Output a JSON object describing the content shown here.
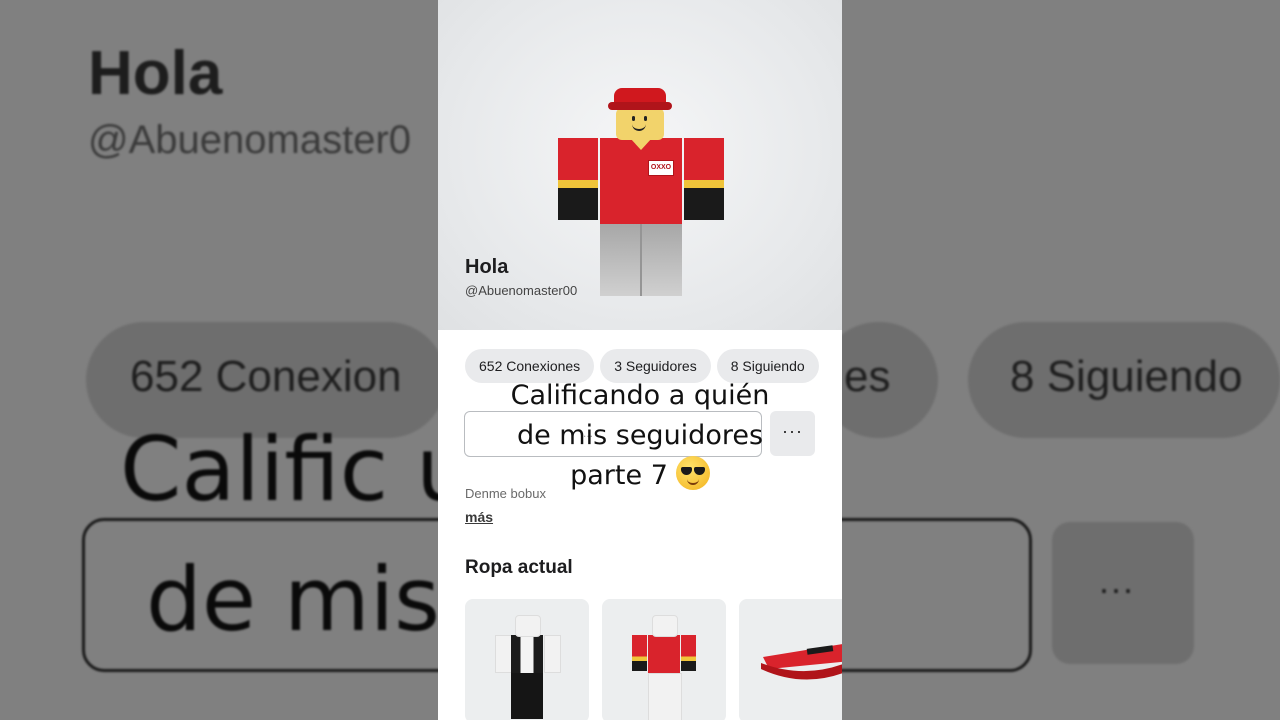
{
  "profile": {
    "display_name": "Hola",
    "username": "@Abuenomaster00"
  },
  "stats": [
    {
      "label": "652 Conexiones"
    },
    {
      "label": "3 Seguidores"
    },
    {
      "label": "8 Siguiendo"
    }
  ],
  "status_input": {
    "partial_text": "..."
  },
  "more_button": {
    "label": "···"
  },
  "bio": {
    "text": "Denme bobux",
    "more_link": "más"
  },
  "current_outfit": {
    "title": "Ropa actual",
    "items": [
      {
        "kind": "tuxedo-outfit"
      },
      {
        "kind": "red-shirt-outfit"
      },
      {
        "kind": "red-visor-hat"
      }
    ]
  },
  "overlay_caption": {
    "line1": "Calificando a quién",
    "line2": "de mis seguidores",
    "line3": "parte 7",
    "emoji": "smiling-face-with-sunglasses"
  },
  "background_copy": {
    "name": "Hola",
    "handle": "@Abuenomaster0",
    "pill1": "652 Conexion",
    "pill2": "es",
    "pill3": "8 Siguiendo",
    "caption1": "Calific            uién",
    "caption2": "de mis           ores",
    "more": "···"
  },
  "colors": {
    "accent_red": "#d9232c",
    "pill_bg": "#e9eaec",
    "text_primary": "#1d1d1f"
  }
}
